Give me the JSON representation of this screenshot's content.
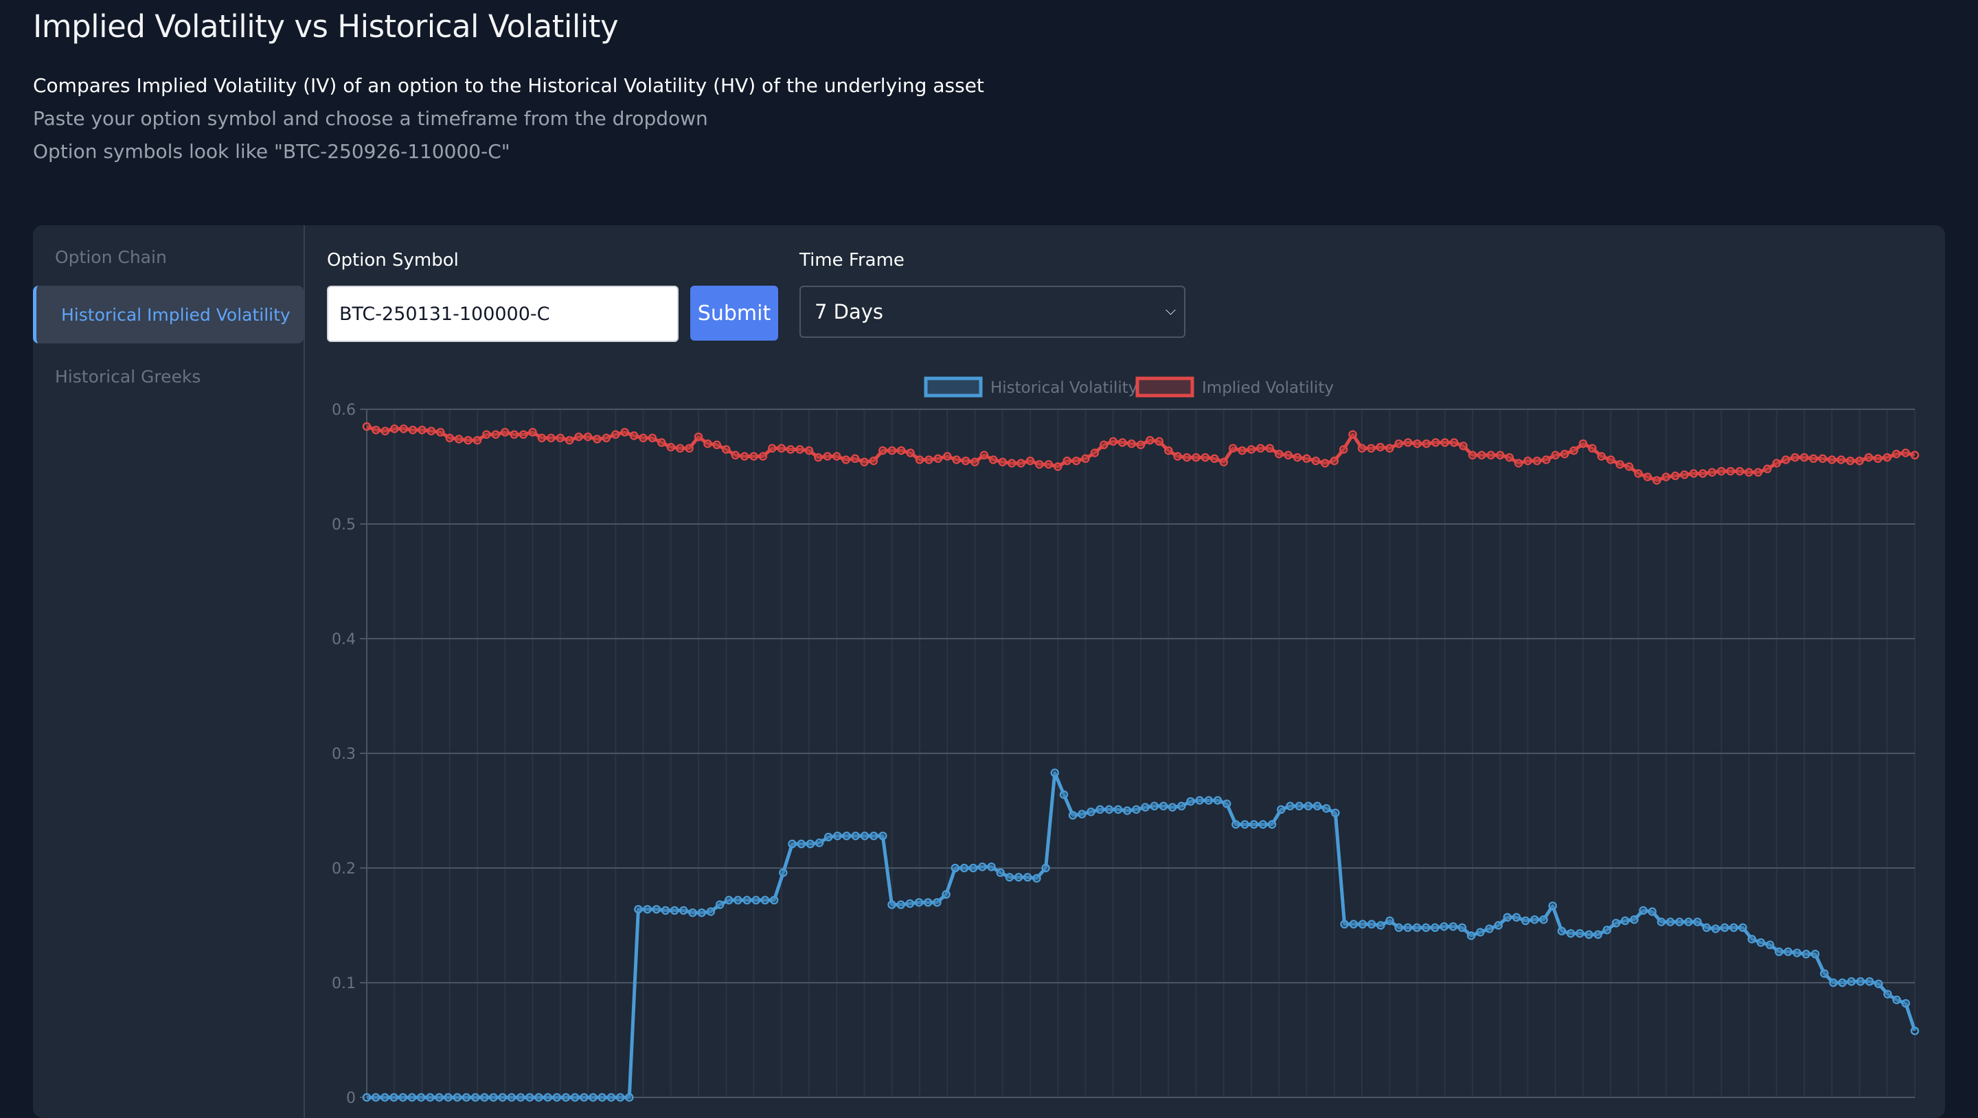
{
  "header": {
    "title": "Implied Volatility vs Historical Volatility",
    "description": "Compares Implied Volatility (IV) of an option to the Historical Volatility (HV) of the underlying asset",
    "instruction": "Paste your option symbol and choose a timeframe from the dropdown",
    "example": "Option symbols look like \"BTC-250926-110000-C\""
  },
  "sidebar": {
    "items": [
      {
        "label": "Option Chain",
        "active": false
      },
      {
        "label": "Historical Implied Volatility",
        "active": true
      },
      {
        "label": "Historical Greeks",
        "active": false
      }
    ]
  },
  "form": {
    "symbol_label": "Option Symbol",
    "symbol_value": "BTC-250131-100000-C",
    "submit_label": "Submit",
    "timeframe_label": "Time Frame",
    "timeframe_value": "7 Days"
  },
  "colors": {
    "historical": "#4a9bd6",
    "implied": "#e04848",
    "accent": "#4f7ef0"
  },
  "chart_data": {
    "type": "line",
    "legend_position": "top-center",
    "grid": true,
    "ylim": [
      0,
      0.6
    ],
    "yticks": [
      "0",
      "0.1",
      "0.2",
      "0.3",
      "0.4",
      "0.5",
      "0.6"
    ],
    "series": [
      {
        "name": "Historical Volatility",
        "values": [
          0,
          0,
          0,
          0,
          0,
          0,
          0,
          0,
          0,
          0,
          0,
          0,
          0,
          0,
          0,
          0,
          0,
          0,
          0,
          0,
          0,
          0,
          0,
          0,
          0,
          0,
          0,
          0,
          0,
          0,
          0.164,
          0.164,
          0.164,
          0.163,
          0.163,
          0.163,
          0.161,
          0.161,
          0.162,
          0.168,
          0.172,
          0.172,
          0.172,
          0.172,
          0.172,
          0.172,
          0.196,
          0.221,
          0.221,
          0.221,
          0.222,
          0.227,
          0.228,
          0.228,
          0.228,
          0.228,
          0.228,
          0.228,
          0.168,
          0.168,
          0.169,
          0.17,
          0.17,
          0.17,
          0.177,
          0.2,
          0.2,
          0.2,
          0.201,
          0.201,
          0.196,
          0.192,
          0.192,
          0.192,
          0.191,
          0.2,
          0.283,
          0.264,
          0.246,
          0.247,
          0.249,
          0.251,
          0.251,
          0.251,
          0.25,
          0.251,
          0.253,
          0.254,
          0.254,
          0.253,
          0.254,
          0.258,
          0.259,
          0.259,
          0.259,
          0.256,
          0.238,
          0.238,
          0.238,
          0.238,
          0.238,
          0.251,
          0.254,
          0.254,
          0.254,
          0.254,
          0.252,
          0.248,
          0.151,
          0.151,
          0.151,
          0.151,
          0.15,
          0.154,
          0.148,
          0.148,
          0.148,
          0.148,
          0.148,
          0.149,
          0.149,
          0.148,
          0.141,
          0.144,
          0.147,
          0.15,
          0.157,
          0.157,
          0.154,
          0.155,
          0.155,
          0.167,
          0.145,
          0.143,
          0.143,
          0.142,
          0.142,
          0.146,
          0.152,
          0.154,
          0.155,
          0.163,
          0.162,
          0.153,
          0.153,
          0.153,
          0.153,
          0.153,
          0.148,
          0.147,
          0.148,
          0.148,
          0.148,
          0.138,
          0.135,
          0.133,
          0.127,
          0.127,
          0.126,
          0.125,
          0.125,
          0.108,
          0.1,
          0.1,
          0.101,
          0.101,
          0.101,
          0.099,
          0.09,
          0.085,
          0.082,
          0.058
        ]
      },
      {
        "name": "Implied Volatility",
        "values": [
          0.585,
          0.582,
          0.581,
          0.583,
          0.583,
          0.582,
          0.582,
          0.581,
          0.58,
          0.575,
          0.574,
          0.573,
          0.573,
          0.578,
          0.578,
          0.58,
          0.578,
          0.578,
          0.58,
          0.575,
          0.575,
          0.575,
          0.573,
          0.576,
          0.576,
          0.574,
          0.575,
          0.578,
          0.58,
          0.577,
          0.575,
          0.575,
          0.571,
          0.567,
          0.566,
          0.566,
          0.576,
          0.57,
          0.569,
          0.565,
          0.56,
          0.559,
          0.559,
          0.559,
          0.566,
          0.566,
          0.565,
          0.565,
          0.564,
          0.558,
          0.559,
          0.559,
          0.556,
          0.557,
          0.554,
          0.555,
          0.564,
          0.564,
          0.564,
          0.562,
          0.556,
          0.556,
          0.557,
          0.559,
          0.556,
          0.555,
          0.554,
          0.56,
          0.556,
          0.554,
          0.553,
          0.553,
          0.555,
          0.552,
          0.552,
          0.55,
          0.555,
          0.555,
          0.557,
          0.562,
          0.569,
          0.572,
          0.571,
          0.57,
          0.569,
          0.573,
          0.572,
          0.564,
          0.559,
          0.558,
          0.558,
          0.558,
          0.557,
          0.554,
          0.566,
          0.564,
          0.565,
          0.566,
          0.566,
          0.561,
          0.56,
          0.558,
          0.557,
          0.555,
          0.553,
          0.555,
          0.565,
          0.578,
          0.566,
          0.566,
          0.567,
          0.566,
          0.57,
          0.571,
          0.57,
          0.57,
          0.571,
          0.571,
          0.571,
          0.568,
          0.56,
          0.56,
          0.56,
          0.56,
          0.558,
          0.553,
          0.555,
          0.555,
          0.556,
          0.56,
          0.561,
          0.564,
          0.57,
          0.566,
          0.559,
          0.556,
          0.552,
          0.55,
          0.544,
          0.541,
          0.538,
          0.541,
          0.542,
          0.543,
          0.544,
          0.544,
          0.545,
          0.546,
          0.546,
          0.546,
          0.545,
          0.545,
          0.548,
          0.553,
          0.556,
          0.558,
          0.558,
          0.557,
          0.557,
          0.556,
          0.556,
          0.555,
          0.555,
          0.558,
          0.557,
          0.558,
          0.561,
          0.562,
          0.56
        ]
      }
    ]
  }
}
